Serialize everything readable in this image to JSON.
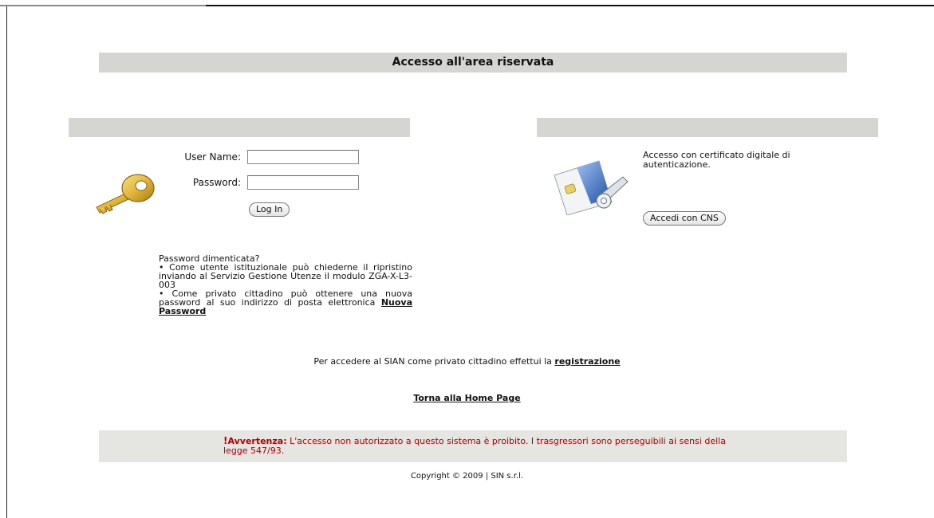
{
  "header": {
    "title": "Accesso all'area riservata"
  },
  "login": {
    "username_label": "User Name:",
    "password_label": "Password:",
    "username_value": "",
    "password_value": "",
    "login_button": "Log In",
    "icon": "key-icon"
  },
  "forgot": {
    "heading": "Password dimenticata?",
    "bullet1": "• Come utente istituzionale può chiederne il ripristino inviando al Servizio Gestione Utenze il modulo ZGA-X-L3-003",
    "bullet2_text": "• Come privato cittadino può ottenere una nuova password al suo indirizzo di posta elettronica",
    "bullet2_link": "Nuova Password"
  },
  "cns": {
    "description": "Accesso con certificato digitale di autenticazione.",
    "button": "Accedi con CNS",
    "icon": "smart-card-icon"
  },
  "registration": {
    "text": "Per accedere al SIAN come privato cittadino effettui la",
    "link": "registrazione"
  },
  "home_link": "Torna alla Home Page",
  "warning": {
    "mark": "!",
    "label": "Avvertenza:",
    "text": "L'accesso non autorizzato a questo sistema è proibito. I trasgressori sono perseguibili ai sensi della legge 547/93.",
    "color": "#b20000"
  },
  "footer": {
    "copyright": "Copyright © 2009 | SIN s.r.l."
  },
  "colors": {
    "bar": "#d5d5d1",
    "warning_bg": "#e5e5e2"
  }
}
